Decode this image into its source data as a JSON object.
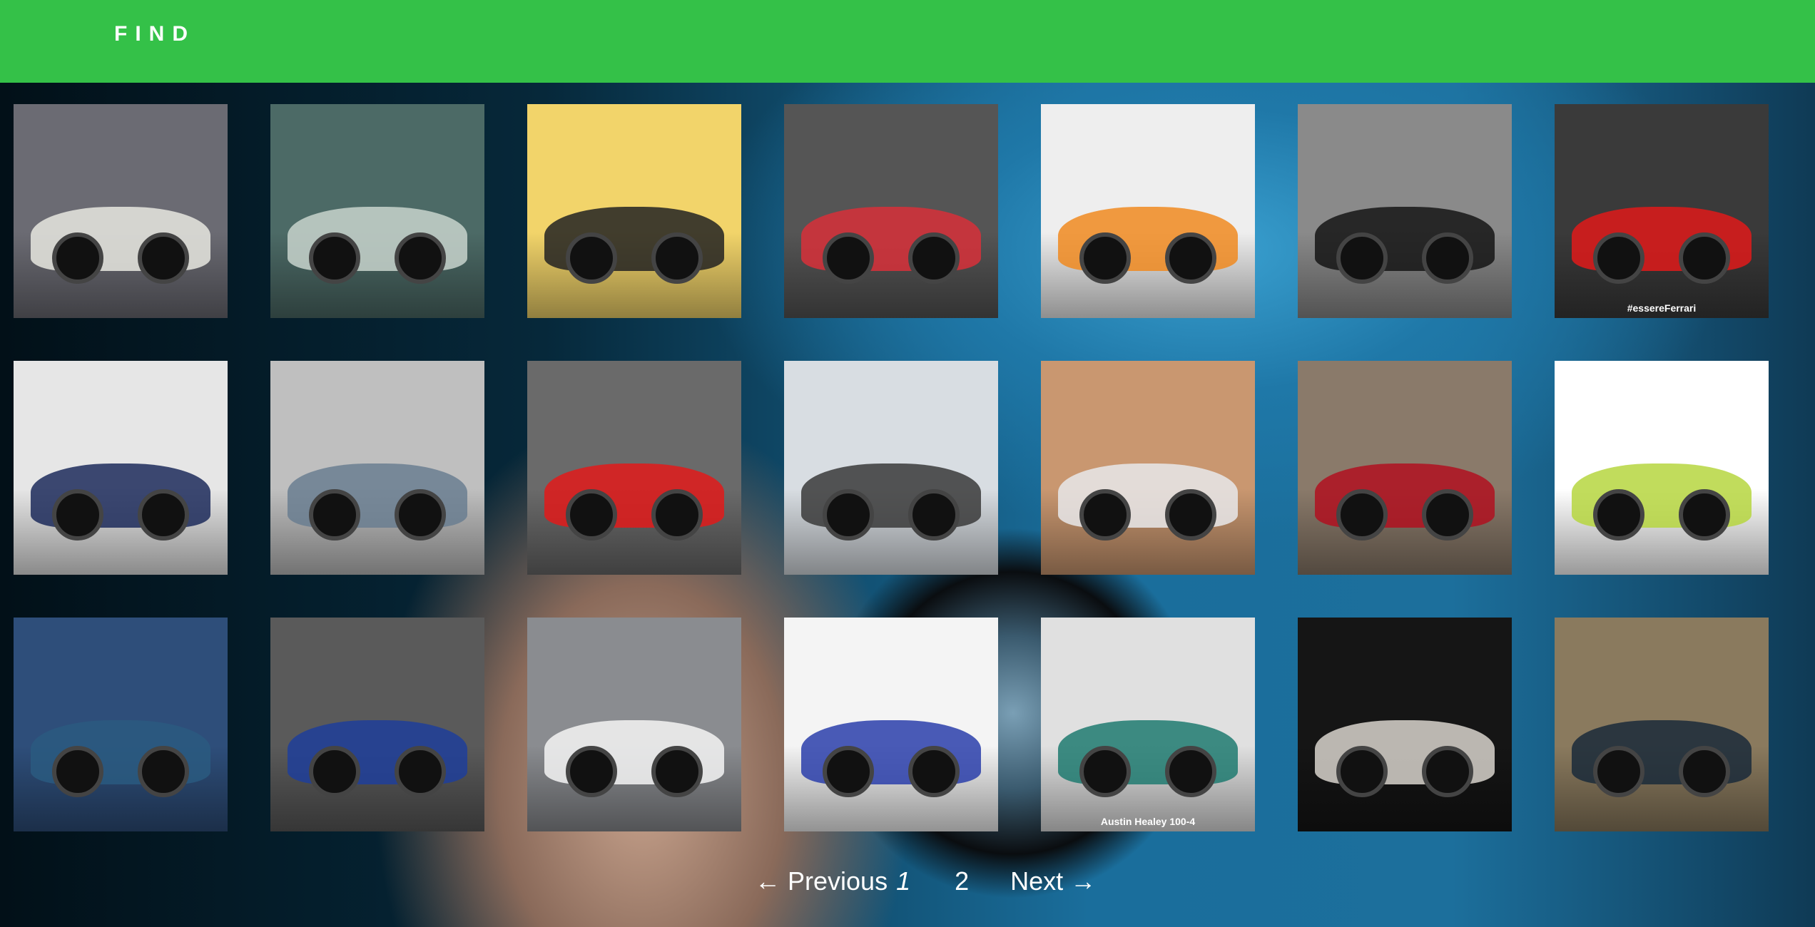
{
  "header": {
    "brand": "FIND",
    "color": "#34c148"
  },
  "tiles": [
    {
      "bg": "#6b6b73",
      "car": "#e8e8e0",
      "caption": ""
    },
    {
      "bg": "#4c6a66",
      "car": "#c8d4cc",
      "caption": ""
    },
    {
      "bg": "#f2d46a",
      "car": "#222222",
      "caption": ""
    },
    {
      "bg": "#555555",
      "car": "#d8303a",
      "caption": ""
    },
    {
      "bg": "#eeeeee",
      "car": "#f08a20",
      "caption": ""
    },
    {
      "bg": "#8a8a8a",
      "car": "#151515",
      "caption": ""
    },
    {
      "bg": "#3a3a3a",
      "car": "#e01a1a",
      "caption": "#essereFerrari"
    },
    {
      "bg": "#e6e6e6",
      "car": "#1c2a5a",
      "caption": ""
    },
    {
      "bg": "#bfbfbf",
      "car": "#6a7e90",
      "caption": ""
    },
    {
      "bg": "#6a6a6a",
      "car": "#e21a1a",
      "caption": ""
    },
    {
      "bg": "#d8dde2",
      "car": "#3a3a3a",
      "caption": ""
    },
    {
      "bg": "#c99770",
      "car": "#e8e8ea",
      "caption": ""
    },
    {
      "bg": "#8a7a6a",
      "car": "#b01020",
      "caption": ""
    },
    {
      "bg": "#ffffff",
      "car": "#b6d640",
      "caption": ""
    },
    {
      "bg": "#2e4e7a",
      "car": "#2a5a80",
      "caption": ""
    },
    {
      "bg": "#5a5a5a",
      "car": "#1e3e9a",
      "caption": ""
    },
    {
      "bg": "#8a8c90",
      "car": "#f4f4f4",
      "caption": ""
    },
    {
      "bg": "#f4f4f4",
      "car": "#2a3eaa",
      "caption": ""
    },
    {
      "bg": "#e0e0e0",
      "car": "#1e7a70",
      "caption": "Austin Healey 100-4"
    },
    {
      "bg": "#151515",
      "car": "#d8d4cc",
      "caption": ""
    },
    {
      "bg": "#8a7a5e",
      "car": "#1a2a3a",
      "caption": ""
    }
  ],
  "pagination": {
    "previous": "← Previous",
    "page1": "1",
    "page2": "2",
    "next": "Next →",
    "current": 1
  }
}
